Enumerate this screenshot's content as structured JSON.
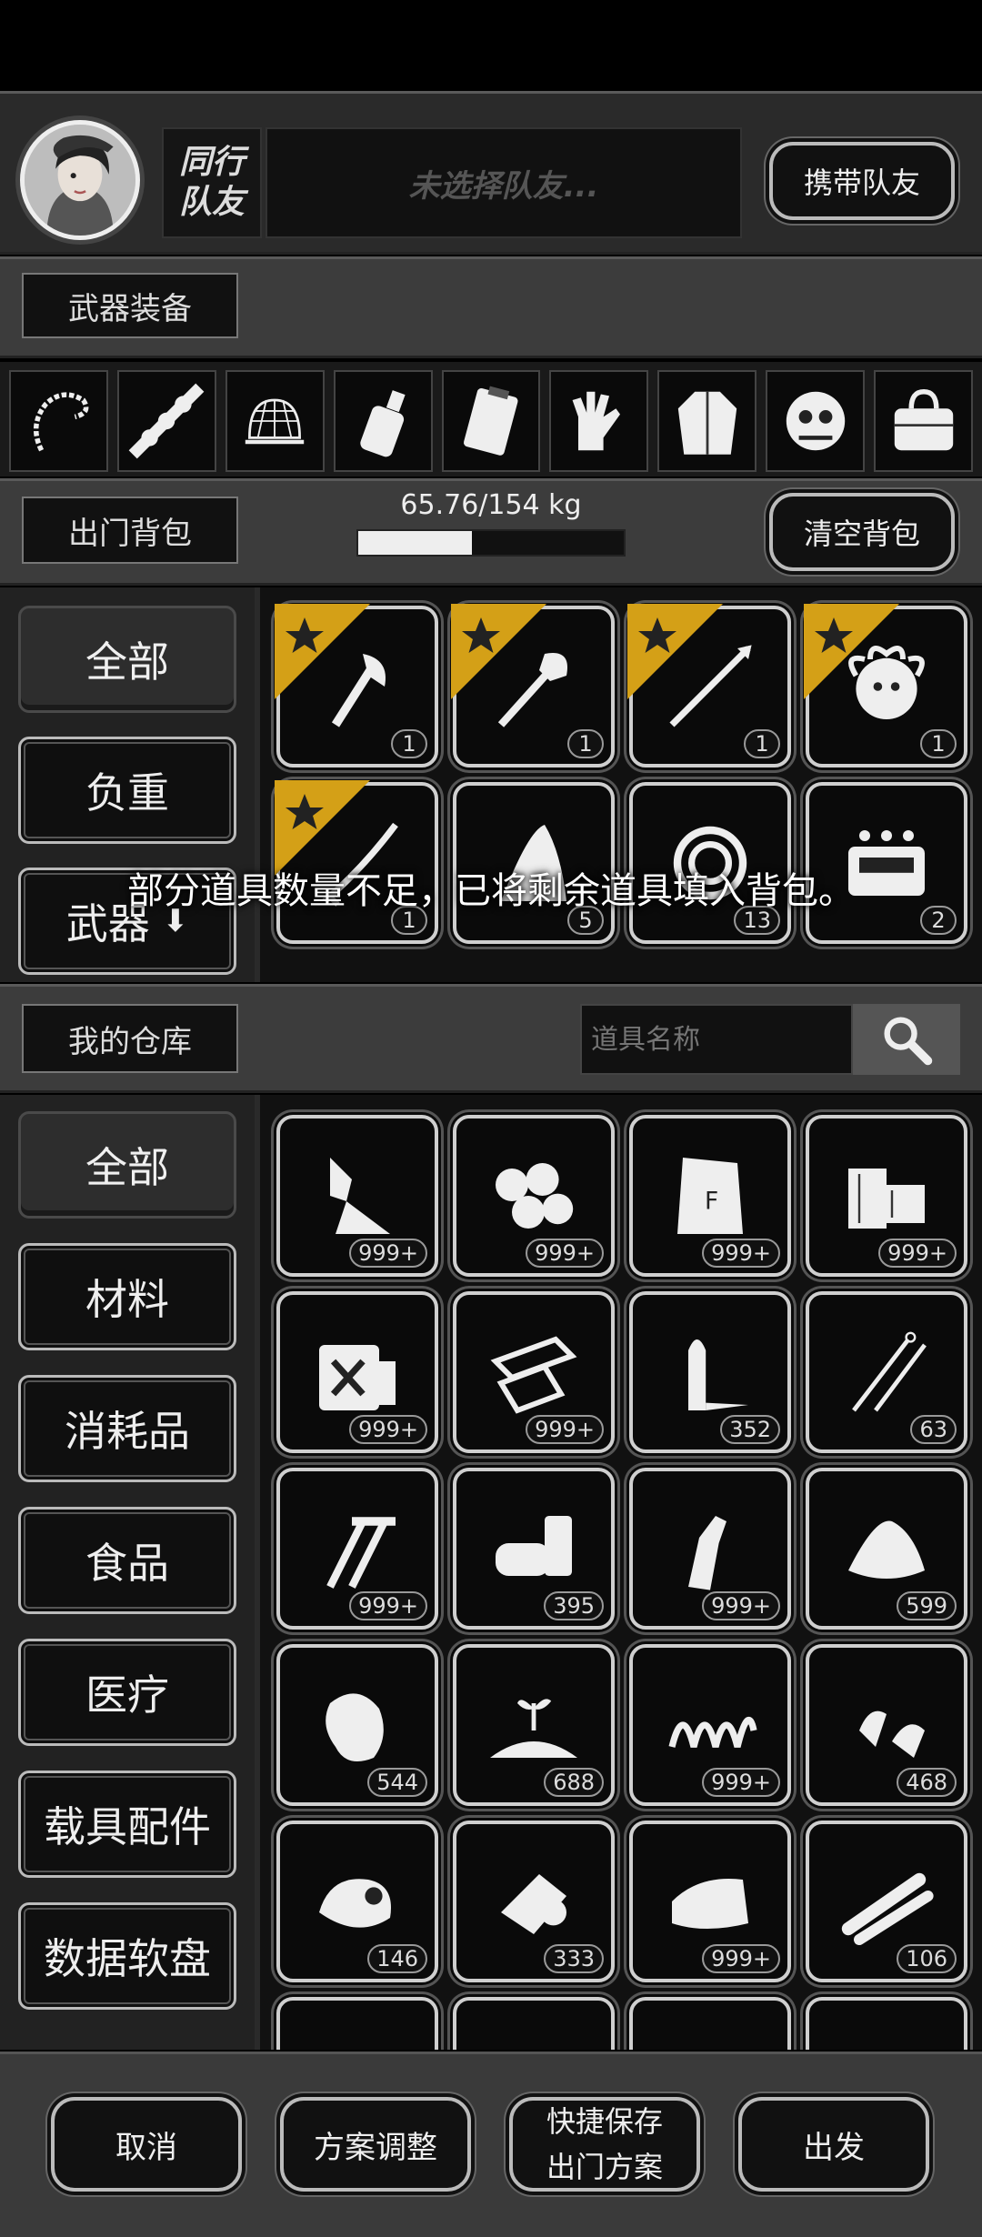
{
  "teammate": {
    "title_line1": "同行",
    "title_line2": "队友",
    "status": "未选择队友...",
    "carry_button": "携带队友"
  },
  "weapons": {
    "section_label": "武器装备"
  },
  "equipment_icons": [
    "rope-icon",
    "grenade-belt-icon",
    "net-icon",
    "bottle-icon",
    "clipboard-icon",
    "gloves-icon",
    "jacket-icon",
    "ghillie-mask-icon",
    "bag-icon"
  ],
  "backpack": {
    "section_label": "出门背包",
    "weight_text": "65.76/154 kg",
    "weight_fraction": 0.427,
    "clear_button": "清空背包",
    "categories": [
      "全部",
      "负重",
      "武器"
    ],
    "items": [
      {
        "icon": "axe-icon",
        "count": "1",
        "starred": true
      },
      {
        "icon": "shovel-icon",
        "count": "1",
        "starred": true
      },
      {
        "icon": "spear-icon",
        "count": "1",
        "starred": true
      },
      {
        "icon": "medusa-emblem-icon",
        "count": "1",
        "starred": true
      },
      {
        "icon": "katana-icon",
        "count": "1",
        "starred": true
      },
      {
        "icon": "shark-fin-icon",
        "count": "5",
        "starred": false
      },
      {
        "icon": "rope-coil-icon",
        "count": "13",
        "starred": false
      },
      {
        "icon": "radio-device-icon",
        "count": "2",
        "starred": false
      }
    ],
    "toast": "部分道具数量不足，已将剩余道具填入背包。"
  },
  "warehouse": {
    "section_label": "我的仓库",
    "search_placeholder": "道具名称",
    "categories": [
      "全部",
      "材料",
      "消耗品",
      "食品",
      "医疗",
      "载具配件",
      "数据软盘"
    ],
    "items": [
      {
        "icon": "glue-tube-icon",
        "count": "999+"
      },
      {
        "icon": "cotton-balls-icon",
        "count": "999+"
      },
      {
        "icon": "flour-sack-icon",
        "count": "999+"
      },
      {
        "icon": "wood-planks-icon",
        "count": "999+"
      },
      {
        "icon": "fuel-can-icon",
        "count": "999+"
      },
      {
        "icon": "metal-sheets-icon",
        "count": "999+"
      },
      {
        "icon": "bullet-icon",
        "count": "352"
      },
      {
        "icon": "needles-icon",
        "count": "63"
      },
      {
        "icon": "screws-icon",
        "count": "999+"
      },
      {
        "icon": "cans-icon",
        "count": "395"
      },
      {
        "icon": "glass-bottle-icon",
        "count": "999+"
      },
      {
        "icon": "powder-pile-icon",
        "count": "599"
      },
      {
        "icon": "leather-icon",
        "count": "544"
      },
      {
        "icon": "soil-sprout-icon",
        "count": "688"
      },
      {
        "icon": "spring-icon",
        "count": "999+"
      },
      {
        "icon": "bullet-tips-icon",
        "count": "468"
      },
      {
        "icon": "cloth-bundle-icon",
        "count": "146"
      },
      {
        "icon": "fabric-roll-icon",
        "count": "333"
      },
      {
        "icon": "towel-icon",
        "count": "999+"
      },
      {
        "icon": "pipes-icon",
        "count": "106"
      },
      {
        "icon": "grass-icon",
        "count": ""
      },
      {
        "icon": "feather-icon",
        "count": ""
      },
      {
        "icon": "seeds-icon",
        "count": ""
      },
      {
        "icon": "jars-icon",
        "count": ""
      }
    ]
  },
  "bottom_bar": {
    "cancel": "取消",
    "adjust": "方案调整",
    "quick_save_line1": "快捷保存",
    "quick_save_line2": "出门方案",
    "depart": "出发"
  },
  "colors": {
    "panel": "#3c3c3c",
    "accent_star": "#d4a017",
    "background": "#000000"
  }
}
